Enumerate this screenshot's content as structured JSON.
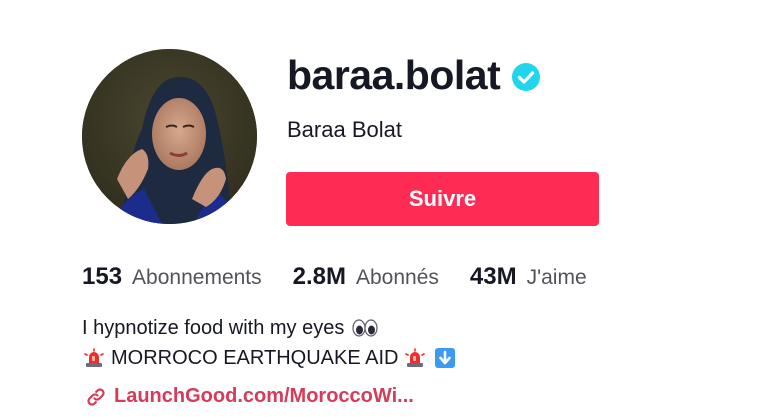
{
  "profile": {
    "username": "baraa.bolat",
    "display_name": "Baraa Bolat",
    "verified": true,
    "follow_label": "Suivre",
    "accent_color": "#fe2c55",
    "verified_color": "#20d5ec"
  },
  "stats": [
    {
      "value": "153",
      "label": "Abonnements"
    },
    {
      "value": "2.8M",
      "label": "Abonnés"
    },
    {
      "value": "43M",
      "label": "J'aime"
    }
  ],
  "bio": {
    "line1": "I hypnotize food with my eyes",
    "line1_emoji": "eyes-emoji",
    "line2": "MORROCO EARTHQUAKE AID",
    "line2_emojis": [
      "police-siren-emoji",
      "police-siren-emoji",
      "down-arrow-emoji"
    ]
  },
  "link": {
    "text": "LaunchGood.com/MoroccoWi...",
    "icon": "link-icon",
    "color": "#d83b5a"
  }
}
